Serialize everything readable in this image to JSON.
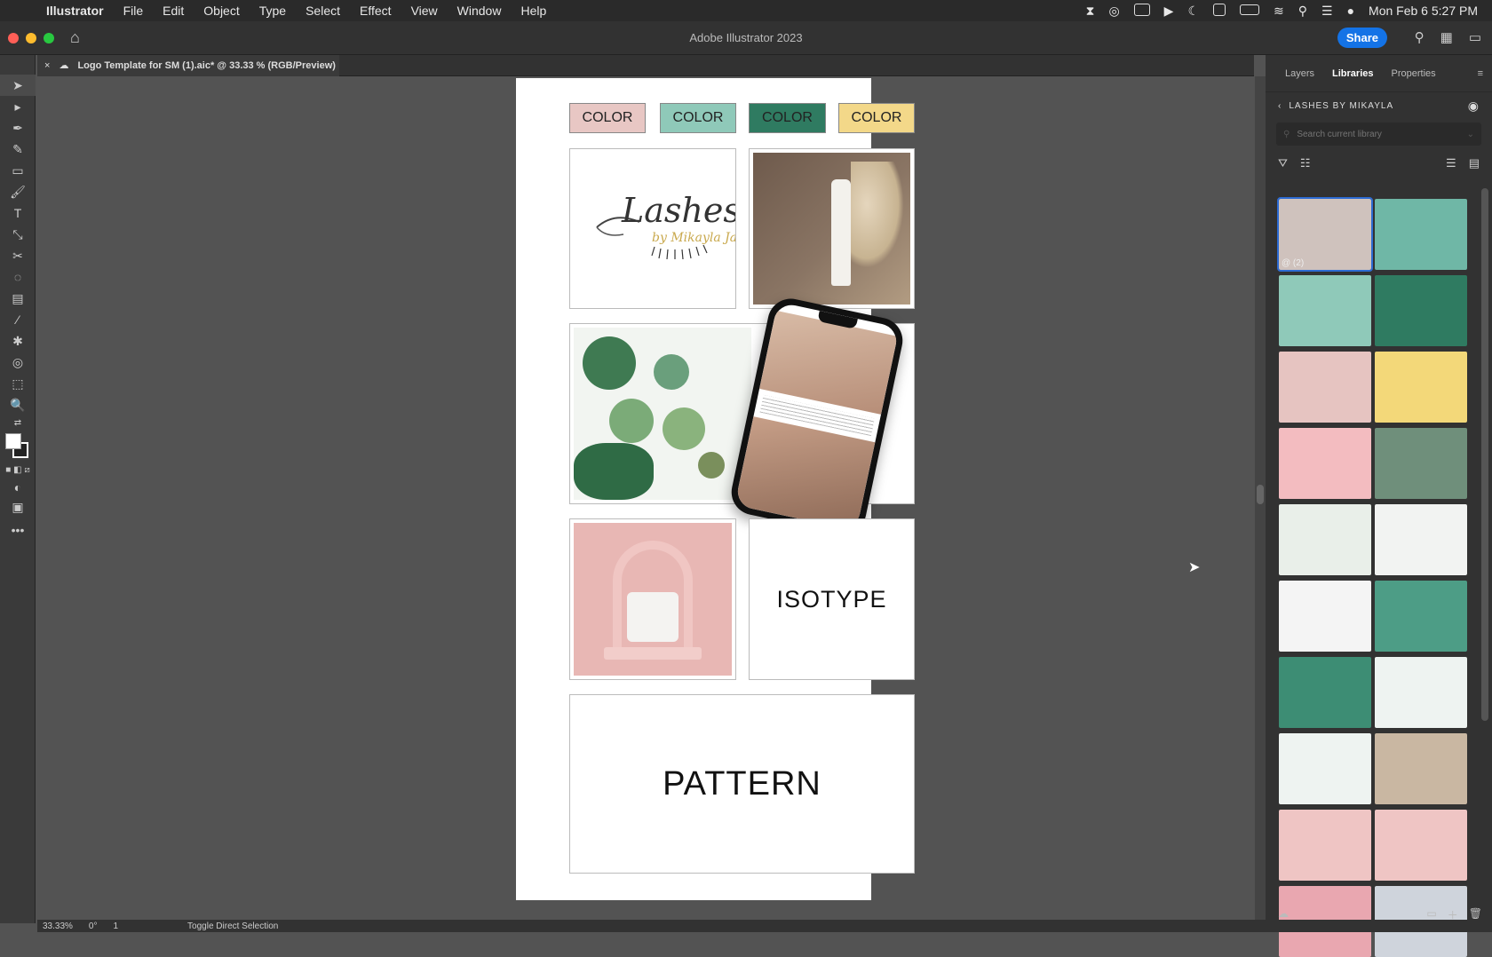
{
  "menubar": {
    "app_name": "Illustrator",
    "items": [
      "File",
      "Edit",
      "Object",
      "Type",
      "Select",
      "Effect",
      "View",
      "Window",
      "Help"
    ],
    "datetime": "Mon Feb 6  5:27 PM"
  },
  "titlebar": {
    "title": "Adobe Illustrator 2023",
    "share_label": "Share"
  },
  "document": {
    "tab_title": "Logo Template for SM (1).aic* @ 33.33 % (RGB/Preview)",
    "close_glyph": "×"
  },
  "artboard": {
    "color_labels": [
      "COLOR",
      "COLOR",
      "COLOR",
      "COLOR"
    ],
    "color_swatches": [
      "#e8c7c4",
      "#8fc9b9",
      "#2f7b61",
      "#f3d889"
    ],
    "isotype_label": "ISOTYPE",
    "pattern_label": "PATTERN",
    "logo_script": "Lashes",
    "logo_sub": "by Mikayla Jai"
  },
  "panel": {
    "tabs": [
      "Layers",
      "Libraries",
      "Properties"
    ],
    "active_tab": "Libraries",
    "library_name": "LASHES BY MIKAYLA",
    "search_placeholder": "Search current library",
    "first_item_badge": "@ (2)",
    "items": [
      {
        "type": "image",
        "color": "#cfc2bd"
      },
      {
        "type": "color",
        "color": "#6fb7a6"
      },
      {
        "type": "color",
        "color": "#8fc9b9"
      },
      {
        "type": "color",
        "color": "#2f7b61"
      },
      {
        "type": "color",
        "color": "#e6c4c1"
      },
      {
        "type": "color",
        "color": "#f3d879"
      },
      {
        "type": "color",
        "color": "#f3bcc0"
      },
      {
        "type": "image",
        "color": "#6f8f7b"
      },
      {
        "type": "image",
        "color": "#e9efe9"
      },
      {
        "type": "image",
        "color": "#f2f3f2"
      },
      {
        "type": "image",
        "color": "#f4f4f4"
      },
      {
        "type": "image",
        "color": "#4d9d86"
      },
      {
        "type": "image",
        "color": "#3d8d74"
      },
      {
        "type": "image",
        "color": "#eef3f1"
      },
      {
        "type": "image",
        "color": "#eef3f1"
      },
      {
        "type": "image",
        "color": "#c9b7a2"
      },
      {
        "type": "image",
        "color": "#efc5c4"
      },
      {
        "type": "image",
        "color": "#efc5c4"
      },
      {
        "type": "image",
        "color": "#e9a7b0"
      },
      {
        "type": "image",
        "color": "#cfd4dc"
      }
    ]
  },
  "status": {
    "zoom": "33.33%",
    "rotation": "0°",
    "artboard_num": "1",
    "tool_hint": "Toggle Direct Selection"
  }
}
